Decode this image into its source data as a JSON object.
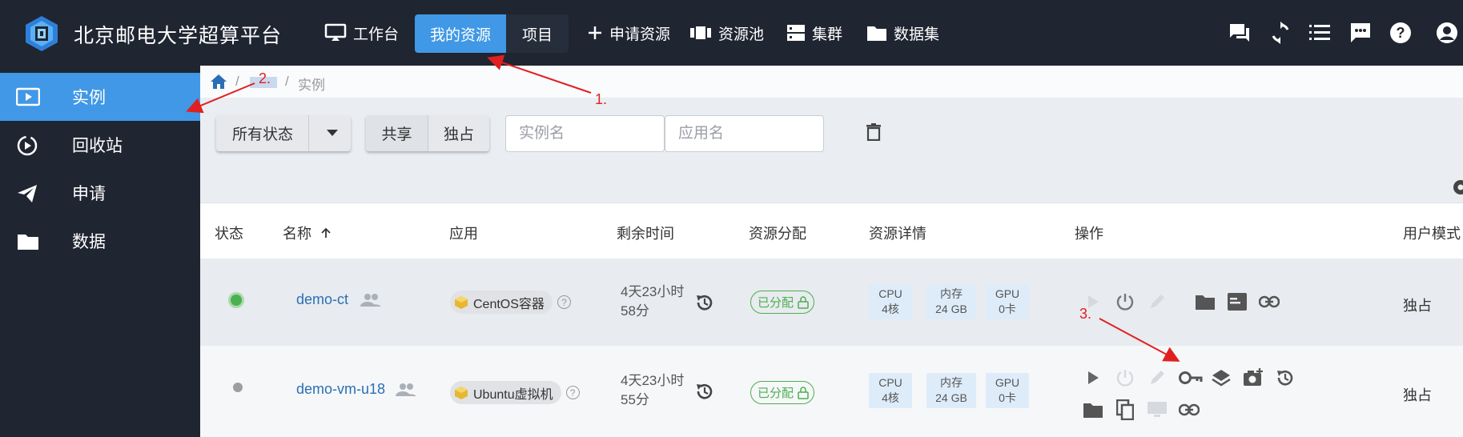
{
  "brand": {
    "title": "北京邮电大学超算平台"
  },
  "topnav": {
    "workbench": "工作台",
    "my_resources": "我的资源",
    "projects": "项目",
    "apply_resources": "申请资源",
    "resource_pool": "资源池",
    "cluster": "集群",
    "datasets": "数据集"
  },
  "top_icons": [
    "chat-icon",
    "sync-icon",
    "list-icon",
    "message-icon",
    "help-icon",
    "account-icon"
  ],
  "sidebar": {
    "items": [
      {
        "label": "实例",
        "icon": "monitor-play-icon",
        "active": true
      },
      {
        "label": "回收站",
        "icon": "recycle-icon",
        "active": false
      },
      {
        "label": "申请",
        "icon": "send-icon",
        "active": false
      },
      {
        "label": "数据",
        "icon": "folder-icon",
        "active": false
      }
    ]
  },
  "breadcrumb": {
    "current": "实例"
  },
  "filters": {
    "status_label": "所有状态",
    "share_label": "共享",
    "exclusive_label": "独占",
    "instance_placeholder": "实例名",
    "app_placeholder": "应用名"
  },
  "table": {
    "headers": {
      "status": "状态",
      "name": "名称",
      "app": "应用",
      "remaining": "剩余时间",
      "allocation": "资源分配",
      "details": "资源详情",
      "actions": "操作",
      "user_mode": "用户模式"
    },
    "rows": [
      {
        "status": "running",
        "name": "demo-ct",
        "app": "CentOS容器",
        "time_line1": "4天23小时",
        "time_line2": "58分",
        "allocation": "已分配",
        "cpu_label": "CPU",
        "cpu_value": "4核",
        "mem_label": "内存",
        "mem_value": "24 GB",
        "gpu_label": "GPU",
        "gpu_value": "0卡",
        "user_mode": "独占"
      },
      {
        "status": "stopped",
        "name": "demo-vm-u18",
        "app": "Ubuntu虚拟机",
        "time_line1": "4天23小时",
        "time_line2": "55分",
        "allocation": "已分配",
        "cpu_label": "CPU",
        "cpu_value": "4核",
        "mem_label": "内存",
        "mem_value": "24 GB",
        "gpu_label": "GPU",
        "gpu_value": "0卡",
        "user_mode": "独占"
      }
    ]
  },
  "annotations": {
    "a1": "1.",
    "a2": "2.",
    "a3": "3."
  },
  "colors": {
    "primary": "#4098e6",
    "topbar": "#1f2531",
    "success": "#4caf50",
    "annotation": "#e02020"
  }
}
